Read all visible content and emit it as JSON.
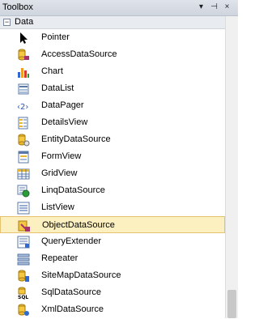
{
  "window": {
    "title": "Toolbox"
  },
  "controls": {
    "dropdown": "▾",
    "pin": "⊣",
    "close": "×"
  },
  "group": {
    "expander": "−",
    "label": "Data"
  },
  "items": [
    {
      "label": "Pointer",
      "icon": "pointer-icon"
    },
    {
      "label": "AccessDataSource",
      "icon": "access-datasource-icon"
    },
    {
      "label": "Chart",
      "icon": "chart-icon"
    },
    {
      "label": "DataList",
      "icon": "datalist-icon"
    },
    {
      "label": "DataPager",
      "icon": "datapager-icon"
    },
    {
      "label": "DetailsView",
      "icon": "detailsview-icon"
    },
    {
      "label": "EntityDataSource",
      "icon": "entity-datasource-icon"
    },
    {
      "label": "FormView",
      "icon": "formview-icon"
    },
    {
      "label": "GridView",
      "icon": "gridview-icon"
    },
    {
      "label": "LinqDataSource",
      "icon": "linq-datasource-icon"
    },
    {
      "label": "ListView",
      "icon": "listview-icon"
    },
    {
      "label": "ObjectDataSource",
      "icon": "object-datasource-icon",
      "selected": true
    },
    {
      "label": "QueryExtender",
      "icon": "queryextender-icon"
    },
    {
      "label": "Repeater",
      "icon": "repeater-icon"
    },
    {
      "label": "SiteMapDataSource",
      "icon": "sitemap-datasource-icon"
    },
    {
      "label": "SqlDataSource",
      "icon": "sql-datasource-icon"
    },
    {
      "label": "XmlDataSource",
      "icon": "xml-datasource-icon"
    }
  ],
  "colors": {
    "selection_bg": "#fcf0c1",
    "selection_border": "#e6c26e",
    "header_bg": "#e8ebf0"
  }
}
